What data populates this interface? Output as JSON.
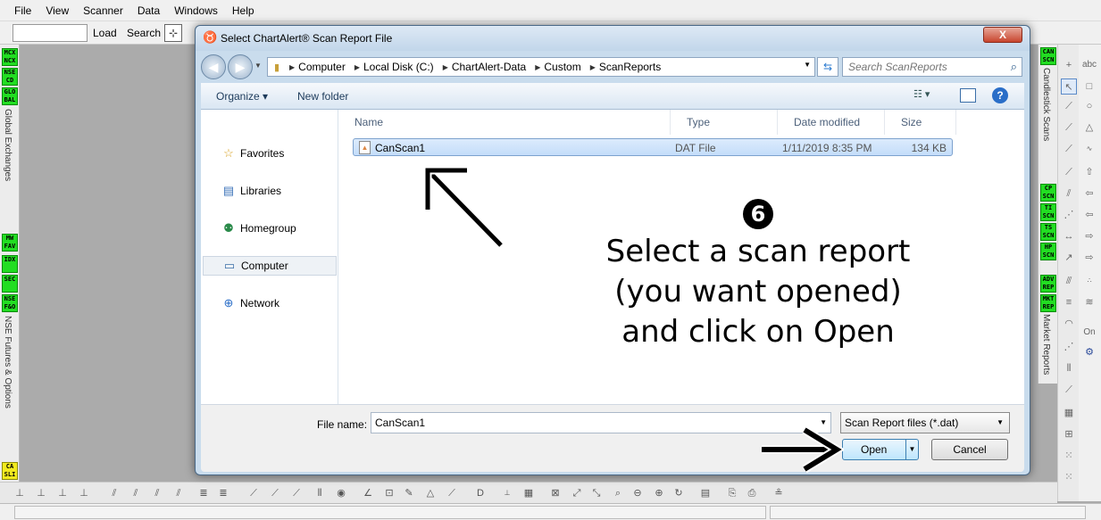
{
  "menu": [
    "File",
    "View",
    "Scanner",
    "Data",
    "Windows",
    "Help"
  ],
  "app_toolbar": {
    "load": "Load",
    "search": "Search"
  },
  "left_panel": {
    "tags_top": [
      "MCX NCX",
      "NSE CD",
      "GLO BAL"
    ],
    "label_top": "Global Exchanges",
    "tags_bottom": [
      "MW FAV",
      "IDX",
      "SEC",
      "NSE F&O"
    ],
    "label_bottom": "NSE Futures & Options",
    "tag_yellow": "CA SLI"
  },
  "right_panel": {
    "tag_top": "CAN SCN",
    "label_top": "Candlestick Scans",
    "tags_mid": [
      "CP SCN",
      "TI SCN",
      "TS SCN",
      "HP SCN"
    ],
    "tags_low": [
      "ADV REP",
      "MKT REP"
    ],
    "label_low": "Market Reports",
    "tools_c_top": "abc",
    "tools_c_on": "On"
  },
  "dialog": {
    "title": "Select ChartAlert® Scan Report File",
    "close": "X",
    "address": [
      "Computer",
      "Local Disk (C:)",
      "ChartAlert-Data",
      "Custom",
      "ScanReports"
    ],
    "search_placeholder": "Search ScanReports",
    "organize": "Organize ▾",
    "new_folder": "New folder",
    "help": "?",
    "nav_items": [
      {
        "icon": "☆",
        "label": "Favorites"
      },
      {
        "icon": "▤",
        "label": "Libraries"
      },
      {
        "icon": "⚉",
        "label": "Homegroup"
      },
      {
        "icon": "▭",
        "label": "Computer"
      },
      {
        "icon": "⊕",
        "label": "Network"
      }
    ],
    "columns": [
      "Name",
      "Type",
      "Date modified",
      "Size"
    ],
    "files": [
      {
        "name": "CanScan1",
        "type": "DAT File",
        "date": "1/11/2019 8:35 PM",
        "size": "134 KB"
      }
    ],
    "file_name_label": "File name:",
    "file_name_value": "CanScan1",
    "file_type": "Scan Report files (*.dat)",
    "open": "Open",
    "cancel": "Cancel"
  },
  "annotation": {
    "step": "6",
    "lines": [
      "Select a scan report",
      "(you want opened)",
      "and click on Open"
    ]
  },
  "colors": {
    "tag_green": "#22dd22",
    "tag_yellow": "#f2ea1e",
    "selected_row": "#c4ddfa",
    "window_frame": "#c9dced"
  }
}
